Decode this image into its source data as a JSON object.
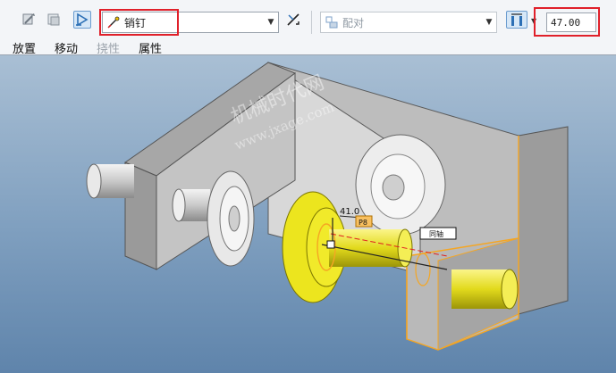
{
  "toolbar": {
    "constraint_type": "销钉",
    "offset_type": "配对",
    "offset_value": "47.00"
  },
  "menu": {
    "placement": "放置",
    "move": "移动",
    "connect": "挠性",
    "properties": "属性"
  },
  "viewport": {
    "watermark_title": "机械时代网",
    "watermark_url": "www.jxage.com",
    "dim_value": "41.0",
    "tag_one": "P8",
    "tag_two": "同轴"
  },
  "colors": {
    "highlight": "#e0202a",
    "selection": "#f5a623",
    "gear_yellow": "#e8e21a"
  },
  "icons": [
    "assembly-icon",
    "plane-icon",
    "pin-icon",
    "swap-icon",
    "mate-icon",
    "offset-icon"
  ]
}
